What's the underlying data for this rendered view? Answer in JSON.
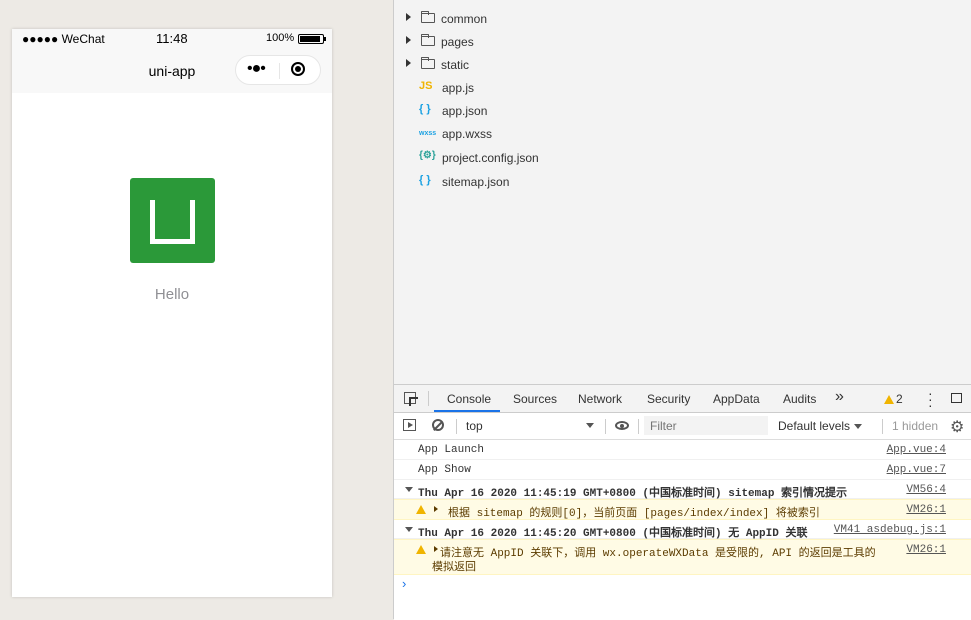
{
  "simulator": {
    "carrier": "●●●●● WeChat",
    "time": "11:48",
    "battery": "100%",
    "nav_title": "uni-app",
    "capsule_dots": "•●•",
    "hello_text": "Hello",
    "logo_color": "#2b9939"
  },
  "file_tree": [
    {
      "type": "folder",
      "name": "common"
    },
    {
      "type": "folder",
      "name": "pages"
    },
    {
      "type": "folder",
      "name": "static"
    },
    {
      "type": "file",
      "name": "app.js",
      "icon": "JS",
      "icon_color": "#f0b400"
    },
    {
      "type": "file",
      "name": "app.json",
      "icon": "{ }",
      "icon_color": "#1ba1e2"
    },
    {
      "type": "file",
      "name": "app.wxss",
      "icon": "wxss",
      "icon_color": "#1ba1e2"
    },
    {
      "type": "file",
      "name": "project.config.json",
      "icon": "{⚙}",
      "icon_color": "#2aa198"
    },
    {
      "type": "file",
      "name": "sitemap.json",
      "icon": "{ }",
      "icon_color": "#1ba1e2"
    }
  ],
  "devtools": {
    "tabs": [
      "Console",
      "Sources",
      "Network",
      "Security",
      "AppData",
      "Audits"
    ],
    "active_tab": "Console",
    "more_tabs": "»",
    "warning_count": "2",
    "context": "top",
    "filter_placeholder": "Filter",
    "levels_label": "Default levels",
    "hidden_label": "1 hidden",
    "accent": "#1a73e8"
  },
  "console": {
    "lines": [
      {
        "kind": "log",
        "text": "App Launch",
        "source": "App.vue:4"
      },
      {
        "kind": "log",
        "text": "App Show",
        "source": "App.vue:7"
      },
      {
        "kind": "group",
        "text": "Thu Apr 16 2020 11:45:19 GMT+0800 (中国标准时间) sitemap 索引情况提示",
        "source": "VM56:4"
      },
      {
        "kind": "warn",
        "text": "根据 sitemap 的规则[0]，当前页面 [pages/index/index] 将被索引",
        "source": "VM26:1"
      },
      {
        "kind": "group",
        "text": "Thu Apr 16 2020 11:45:20 GMT+0800 (中国标准时间) 无 AppID 关联",
        "source": "VM41 asdebug.js:1"
      },
      {
        "kind": "warn",
        "text": "请注意无 AppID 关联下，调用 wx.operateWXData 是受限的, API 的返回是工具的",
        "text2": "模拟返回",
        "source": "VM26:1"
      }
    ],
    "prompt": "›"
  }
}
